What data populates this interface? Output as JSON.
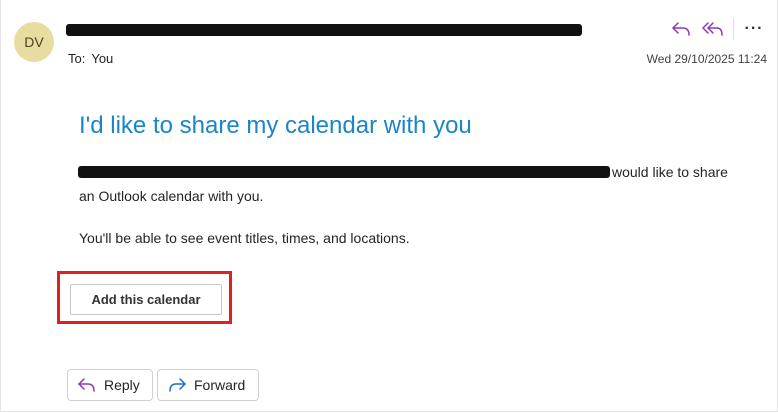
{
  "header": {
    "avatar_initials": "DV",
    "to_label": "To:",
    "to_name": "You",
    "timestamp": "Wed 29/10/2025 11:24",
    "actions": [
      {
        "icon": "reply-icon"
      },
      {
        "icon": "reply-all-icon"
      },
      {
        "icon": "more-options-icon",
        "glyph": "···"
      }
    ]
  },
  "body": {
    "heading": "I'd like to share my calendar with you",
    "line1_suffix": "would like to share",
    "line1_cont": "an Outlook calendar with you.",
    "line2": "You'll be able to see event titles, times, and locations.",
    "add_button": "Add this calendar"
  },
  "footer": {
    "reply_label": "Reply",
    "forward_label": "Forward"
  },
  "colors": {
    "accent": "#1a86c8",
    "action_purple": "#8a3ab9",
    "highlight_red": "#e02020",
    "avatar_bg": "#e8dca0"
  }
}
